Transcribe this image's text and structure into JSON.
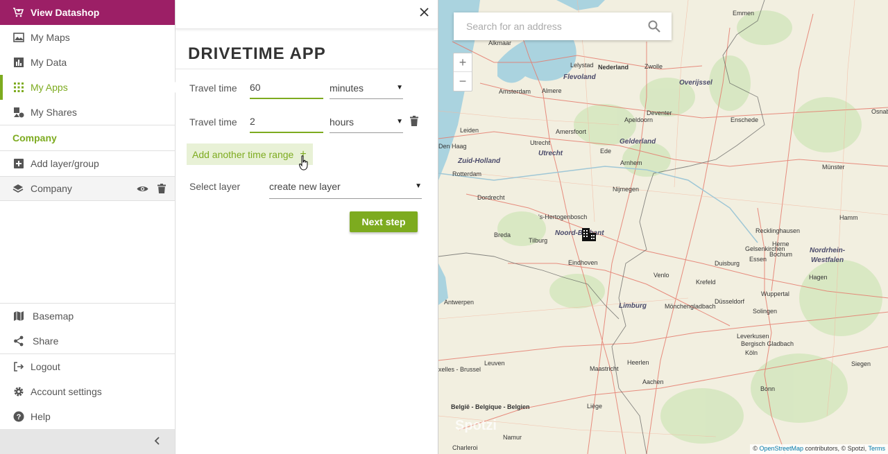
{
  "sidebar": {
    "datashop_label": "View Datashop",
    "nav": [
      {
        "label": "My Maps"
      },
      {
        "label": "My Data"
      },
      {
        "label": "My Apps"
      },
      {
        "label": "My Shares"
      }
    ],
    "group_title": "Company",
    "add_layer_label": "Add layer/group",
    "layer_name": "Company",
    "bottom": {
      "basemap": "Basemap",
      "share": "Share",
      "logout": "Logout",
      "account": "Account settings",
      "help": "Help"
    }
  },
  "panel": {
    "title": "DRIVETIME APP",
    "rows": [
      {
        "label": "Travel time",
        "value": "60",
        "unit": "minutes"
      },
      {
        "label": "Travel time",
        "value": "2",
        "unit": "hours"
      }
    ],
    "add_range_label": "Add another time range",
    "add_range_icon": "+",
    "select_layer_label": "Select layer",
    "select_layer_value": "create new layer",
    "next_label": "Next step"
  },
  "map": {
    "search_placeholder": "Search for an address",
    "zoom_in": "+",
    "zoom_out": "−",
    "labels": {
      "emmen": "Emmen",
      "alkmaar": "Alkmaar",
      "lelystad": "Lelystad",
      "nederland": "Nederland",
      "zwolle": "Zwolle",
      "flevoland": "Flevoland",
      "amsterdam": "Amsterdam",
      "almere": "Almere",
      "overijssel": "Overijssel",
      "deventer": "Deventer",
      "enschede": "Enschede",
      "osnabruck": "Osnabrü",
      "leiden": "Leiden",
      "apeldoorn": "Apeldoorn",
      "amersfoort": "Amersfoort",
      "denhaag": "Den Haag",
      "utrecht": "Utrecht",
      "utrecht_region": "Utrecht",
      "gelderland": "Gelderland",
      "ede": "Ede",
      "zuidholland": "Zuid-Holland",
      "arnhem": "Arnhem",
      "munster": "Münster",
      "rotterdam": "Rotterdam",
      "nijmegen": "Nijmegen",
      "dordrecht": "Dordrecht",
      "shertogenbosch": "'s-Hertogenbosch",
      "hamm": "Hamm",
      "recklinghausen": "Recklinghausen",
      "breda": "Breda",
      "noordbrabant": "Noord-Brabant",
      "tilburg": "Tilburg",
      "herne": "Herne",
      "gelsenkirchen": "Gelsenkirchen",
      "bochum": "Bochum",
      "nrw1": "Nordrhein-",
      "nrw2": "Westfalen",
      "essen": "Essen",
      "eindhoven": "Eindhoven",
      "duisburg": "Duisburg",
      "venlo": "Venlo",
      "hagen": "Hagen",
      "krefeld": "Krefeld",
      "wuppertal": "Wuppertal",
      "antwerpen": "Antwerpen",
      "limburg": "Limburg",
      "monchengladbach": "Mönchengladbach",
      "dusseldorf": "Düsseldorf",
      "solingen": "Solingen",
      "leverkusen": "Leverkusen",
      "bergisch": "Bergisch Gladbach",
      "leuven": "Leuven",
      "maastricht": "Maastricht",
      "heerlen": "Heerlen",
      "koln": "Köln",
      "siegen": "Siegen",
      "brussel": "xelles - Brussel",
      "aachen": "Aachen",
      "bonn": "Bonn",
      "belgie": "België - Belgique - Belgien",
      "liege": "Liège",
      "namur": "Namur",
      "charleroi": "Charleroi",
      "spotzi": "Spotzi"
    },
    "attribution": {
      "prefix": "© ",
      "osm": "OpenStreetMap",
      "middle": " contributors, © Spotzi, ",
      "terms": "Terms"
    }
  },
  "colors": {
    "brand_magenta": "#9c1f66",
    "accent_green": "#7dab1f"
  }
}
